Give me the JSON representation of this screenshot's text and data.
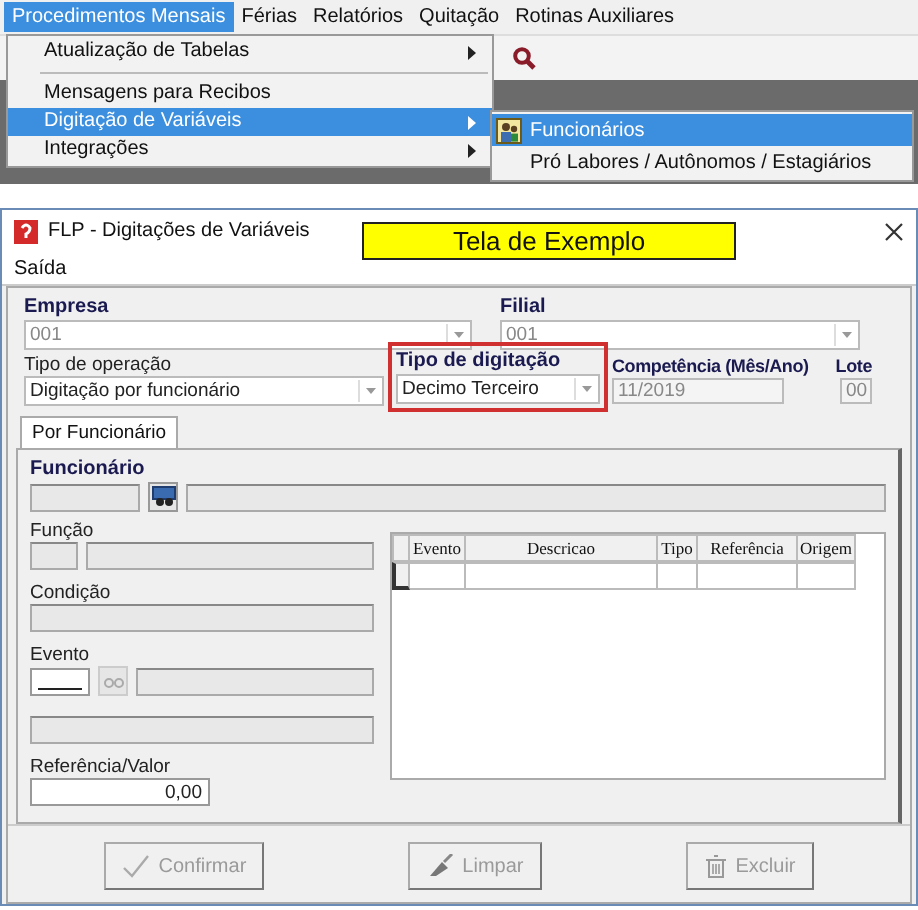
{
  "menubar": [
    {
      "label": "Procedimentos Mensais",
      "selected": true
    },
    {
      "label": "Férias",
      "selected": false
    },
    {
      "label": "Relatórios",
      "selected": false
    },
    {
      "label": "Quitação",
      "selected": false
    },
    {
      "label": "Rotinas Auxiliares",
      "selected": false
    }
  ],
  "dropdown": [
    {
      "kind": "item",
      "label": "Atualização de Tabelas",
      "submenu": true,
      "selected": false
    },
    {
      "kind": "separator"
    },
    {
      "kind": "item",
      "label": "Mensagens para Recibos",
      "submenu": false,
      "selected": false
    },
    {
      "kind": "item",
      "label": "Digitação de Variáveis",
      "submenu": true,
      "selected": true
    },
    {
      "kind": "item",
      "label": "Integrações",
      "submenu": true,
      "selected": false
    }
  ],
  "submenu": [
    {
      "label": "Funcionários",
      "icon": true,
      "selected": true
    },
    {
      "label": "Pró Labores / Autônomos / Estagiários",
      "icon": false,
      "selected": false
    }
  ],
  "window": {
    "title": "FLP - Digitações de Variáveis",
    "banner": "Tela de Exemplo",
    "menu": [
      "Saída"
    ]
  },
  "form": {
    "empresa": {
      "label": "Empresa",
      "value": "001"
    },
    "filial": {
      "label": "Filial",
      "value": "001"
    },
    "tipo_operacao": {
      "label": "Tipo de operação",
      "value": "Digitação por funcionário"
    },
    "tipo_digitacao": {
      "label": "Tipo de digitação",
      "value": "Decimo Terceiro",
      "highlighted": true
    },
    "competencia": {
      "label": "Competência (Mês/Ano)",
      "value": "11/2019"
    },
    "lote": {
      "label": "Lote",
      "value": "00"
    }
  },
  "tabs": [
    {
      "label": "Por Funcionário",
      "selected": true
    }
  ],
  "panel": {
    "funcionario": "Funcionário",
    "funcao": "Função",
    "condicao": "Condição",
    "evento": "Evento",
    "referencia_valor": {
      "label": "Referência/Valor",
      "value": "0,00"
    }
  },
  "table": {
    "columns": [
      "Evento",
      "Descricao",
      "Tipo",
      "Referência",
      "Origem"
    ]
  },
  "buttons": [
    {
      "label": "Confirmar",
      "kind": "confirm",
      "disabled": true
    },
    {
      "label": "Limpar",
      "kind": "clear",
      "disabled": true
    },
    {
      "label": "Excluir",
      "kind": "delete",
      "disabled": true
    }
  ]
}
